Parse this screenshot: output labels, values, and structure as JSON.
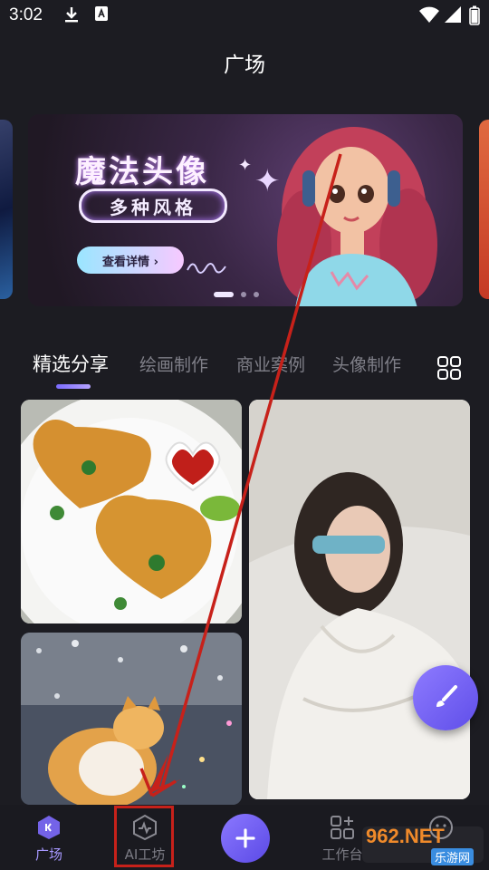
{
  "status_bar": {
    "time": "3:02"
  },
  "header": {
    "title": "广场"
  },
  "banner": {
    "title": "魔法头像",
    "tagline": "多种风格",
    "button_label": "查看详情 ›"
  },
  "tabs": [
    {
      "label": "精选分享",
      "active": true
    },
    {
      "label": "绘画制作",
      "active": false
    },
    {
      "label": "商业案例",
      "active": false
    },
    {
      "label": "头像制作",
      "active": false
    }
  ],
  "feed": {
    "cards": [
      {
        "name": "heart-shaped-schnitzel-image"
      },
      {
        "name": "woman-with-sunglasses-image"
      },
      {
        "name": "cat-on-wet-street-image"
      }
    ]
  },
  "bottom_nav": {
    "items": [
      {
        "label": "广场",
        "active": true,
        "icon": "square-home-icon"
      },
      {
        "label": "AI工坊",
        "active": false,
        "icon": "ai-workshop-icon"
      },
      {
        "label": "工作台",
        "active": false,
        "icon": "workbench-icon"
      }
    ]
  },
  "watermark": {
    "brand": "962.NET",
    "sub": "乐游网"
  },
  "colors": {
    "accent": "#7b6cff",
    "background": "#1c1c22",
    "annotation": "#c7211a"
  }
}
